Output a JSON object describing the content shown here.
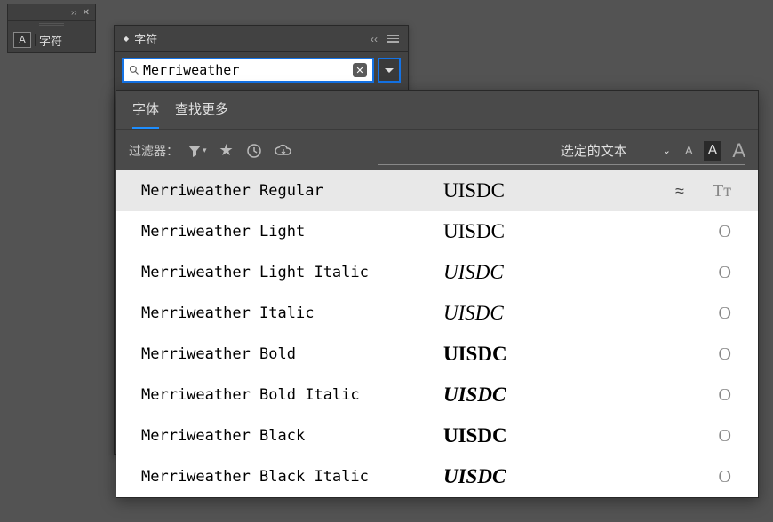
{
  "tool_panel": {
    "char_label": "字符",
    "a_label": "A"
  },
  "char_panel": {
    "title": "字符",
    "collapse_label": "‹‹",
    "search_value": "Merriweather",
    "search_placeholder": ""
  },
  "dropdown": {
    "tabs": {
      "fonts": "字体",
      "find_more": "查找更多"
    },
    "filter_label": "过滤器：",
    "selected_text_label": "选定的文本",
    "sample_text": "UISDC",
    "fonts": [
      {
        "name": "Merriweather Regular",
        "weight": "regular",
        "italic": false,
        "badge": "≈",
        "type": "Tᴛ"
      },
      {
        "name": "Merriweather Light",
        "weight": "light",
        "italic": false,
        "badge": "",
        "type": "O"
      },
      {
        "name": "Merriweather Light Italic",
        "weight": "light",
        "italic": true,
        "badge": "",
        "type": "O"
      },
      {
        "name": "Merriweather Italic",
        "weight": "regular",
        "italic": true,
        "badge": "",
        "type": "O"
      },
      {
        "name": "Merriweather Bold",
        "weight": "bold",
        "italic": false,
        "badge": "",
        "type": "O"
      },
      {
        "name": "Merriweather Bold Italic",
        "weight": "bold",
        "italic": true,
        "badge": "",
        "type": "O"
      },
      {
        "name": "Merriweather Black",
        "weight": "black",
        "italic": false,
        "badge": "",
        "type": "O"
      },
      {
        "name": "Merriweather Black Italic",
        "weight": "black",
        "italic": true,
        "badge": "",
        "type": "O"
      }
    ]
  }
}
